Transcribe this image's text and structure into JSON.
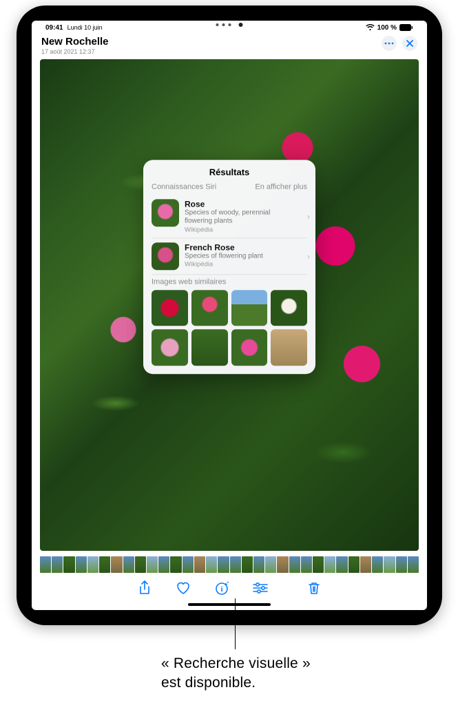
{
  "status": {
    "time": "09:41",
    "date": "Lundi 10 juin",
    "battery_text": "100 %"
  },
  "header": {
    "title": "New Rochelle",
    "subtitle": "17 août 2021  12:37"
  },
  "popup": {
    "title": "Résultats",
    "section_label": "Connaissances Siri",
    "more_label": "En afficher plus",
    "results": [
      {
        "name": "Rose",
        "desc": "Species of woody, perennial flowering plants",
        "source": "Wikipédia"
      },
      {
        "name": "French Rose",
        "desc": "Species of flowering plant",
        "source": "Wikipédia"
      }
    ],
    "similar_label": "Images web similaires"
  },
  "icons": {
    "more": "ellipsis-icon",
    "close": "close-icon",
    "share": "share-icon",
    "favorite": "heart-icon",
    "info": "info-sparkle-icon",
    "adjust": "sliders-icon",
    "trash": "trash-icon",
    "wifi": "wifi-icon",
    "battery": "battery-icon"
  },
  "callout": {
    "line1": "« Recherche visuelle »",
    "line2": "est disponible."
  },
  "colors": {
    "accent": "#0a7aff"
  }
}
